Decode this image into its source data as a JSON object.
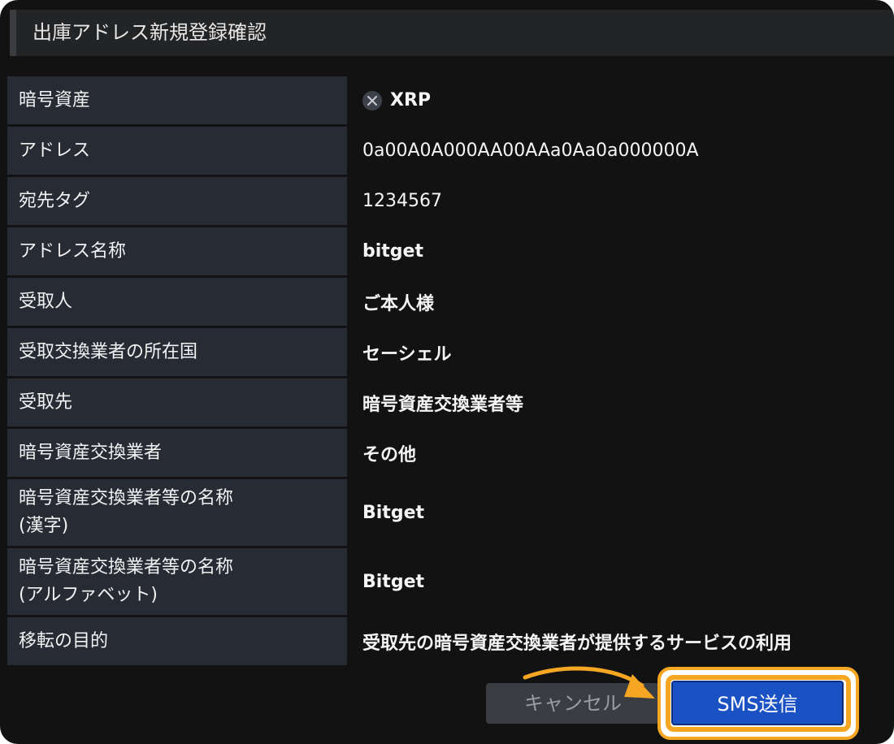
{
  "dialog": {
    "title": "出庫アドレス新規登録確認"
  },
  "rows": [
    {
      "label": "暗号資産",
      "value": "XRP",
      "icon": "xrp-icon"
    },
    {
      "label": "アドレス",
      "value": "0a00A0A000AA00AAa0Aa0a000000A"
    },
    {
      "label": "宛先タグ",
      "value": "1234567"
    },
    {
      "label": "アドレス名称",
      "value": "bitget"
    },
    {
      "label": "受取人",
      "value": "ご本人様"
    },
    {
      "label": "受取交換業者の所在国",
      "value": "セーシェル"
    },
    {
      "label": "受取先",
      "value": "暗号資産交換業者等"
    },
    {
      "label": "暗号資産交換業者",
      "value": "その他"
    },
    {
      "label": "暗号資産交換業者等の名称\n(漢字)",
      "value": "Bitget"
    },
    {
      "label": "暗号資産交換業者等の名称\n(アルファベット)",
      "value": "Bitget"
    },
    {
      "label": "移転の目的",
      "value": "受取先の暗号資産交換業者が提供するサービスの利用"
    }
  ],
  "buttons": {
    "cancel_label": "キャンセル",
    "submit_label": "SMS送信"
  },
  "colors": {
    "highlight": "#f5a623",
    "primary_button": "#1a52c4"
  }
}
